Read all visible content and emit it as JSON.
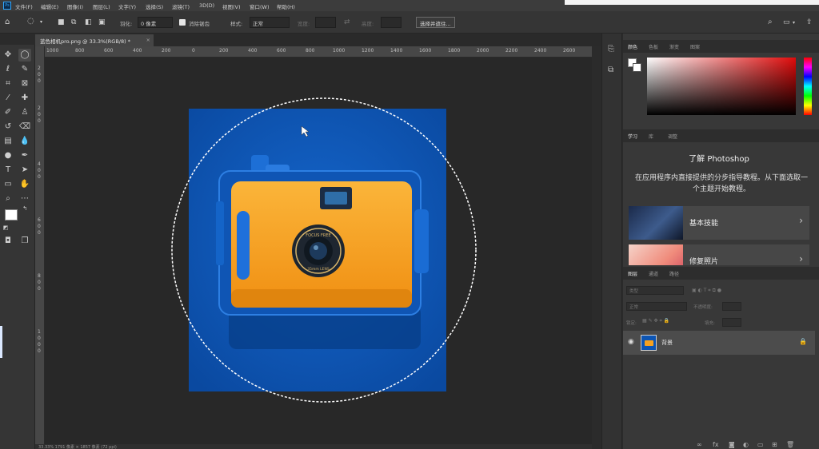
{
  "menu": {
    "logo": "Ps",
    "items": [
      "文件(F)",
      "编辑(E)",
      "图像(I)",
      "图层(L)",
      "文字(Y)",
      "选择(S)",
      "滤镜(T)",
      "3D(D)",
      "视图(V)",
      "窗口(W)",
      "帮助(H)"
    ]
  },
  "options": {
    "feather_label": "羽化:",
    "feather_value": "0 像素",
    "antialias_label": "消除锯齿",
    "style_label": "样式:",
    "style_value": "正常",
    "width_label": "宽度:",
    "height_label": "高度:",
    "select_subject": "选择并遮住..."
  },
  "document": {
    "tab_title": "蓝色相机pro.png @ 33.3%(RGB/8) *",
    "close": "×"
  },
  "ruler": {
    "h_ticks": [
      "1000",
      "800",
      "600",
      "400",
      "200",
      "0",
      "200",
      "400",
      "600",
      "800",
      "1000",
      "1200",
      "1400",
      "1600",
      "1800",
      "2000",
      "2200",
      "2400",
      "2600"
    ],
    "v_ticks": [
      "2",
      "0",
      "0",
      "2",
      "0",
      "0",
      "4",
      "0",
      "0",
      "6",
      "0",
      "0",
      "8",
      "0",
      "0",
      "1",
      "0",
      "0",
      "0"
    ]
  },
  "camera": {
    "lens_text_top": "FOCUS FREE",
    "lens_text_bottom": "35mm LENS"
  },
  "status": {
    "text": "33.33%    1791 像素 × 1857 像素 (72 ppi)"
  },
  "color_panel": {
    "tabs": [
      "颜色",
      "色板",
      "渐变",
      "图案"
    ]
  },
  "learn_panel": {
    "tabs": [
      "学习",
      "库",
      "调整"
    ],
    "title": "了解 Photoshop",
    "description": "在应用程序内直接提供的分步指导教程。从下面选取一个主题开始教程。",
    "cards": [
      {
        "label": "基本技能",
        "arrow": "›"
      },
      {
        "label": "修复照片",
        "arrow": "›"
      }
    ]
  },
  "layers_panel": {
    "tabs": [
      "图层",
      "通道",
      "路径"
    ],
    "filter_label": "类型",
    "blend_mode": "正常",
    "opacity_label": "不透明度:",
    "lock_label": "锁定:",
    "fill_label": "填充:",
    "layer_name": "背景"
  },
  "colors": {
    "blue_bg": "#0d55b3",
    "camera_orange": "#f6a11e",
    "accent": "#31a8ff"
  }
}
